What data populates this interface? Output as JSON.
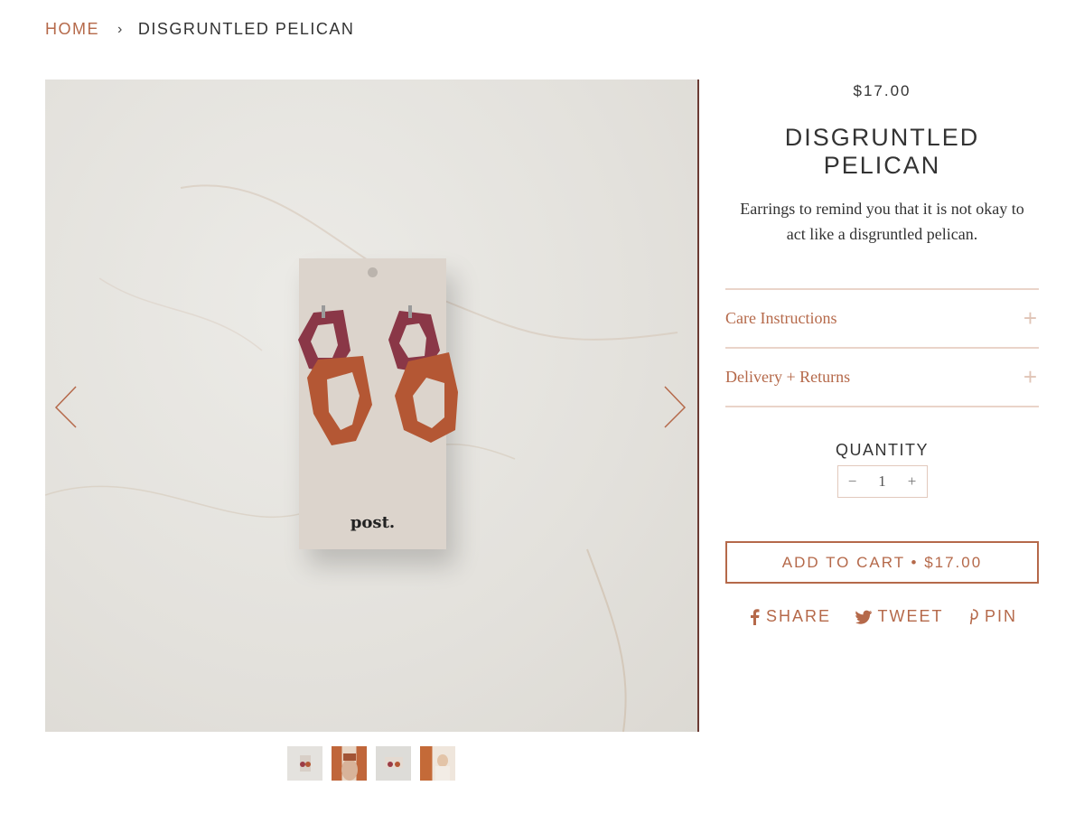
{
  "breadcrumb": {
    "home": "HOME",
    "separator": "›",
    "current": "DISGRUNTLED PELICAN"
  },
  "gallery": {
    "card_brand": "post.",
    "thumbnail_count": 4,
    "prev_icon": "chevron-left-icon",
    "next_icon": "chevron-right-icon"
  },
  "product": {
    "price": "$17.00",
    "title": "DISGRUNTLED PELICAN",
    "description": "Earrings to remind you that it is not okay to act like a disgruntled pelican."
  },
  "accordion": [
    {
      "label": "Care Instructions",
      "icon": "+"
    },
    {
      "label": "Delivery + Returns",
      "icon": "+"
    }
  ],
  "quantity": {
    "label": "QUANTITY",
    "minus": "−",
    "value": "1",
    "plus": "+"
  },
  "add_to_cart": "ADD TO CART • $17.00",
  "share": {
    "facebook": "SHARE",
    "twitter": "TWEET",
    "pinterest": "PIN"
  },
  "colors": {
    "accent": "#b5694a",
    "divider": "#ead4c9",
    "text": "#333333",
    "earring_plum": "#8a3747",
    "earring_rust": "#b45734"
  }
}
